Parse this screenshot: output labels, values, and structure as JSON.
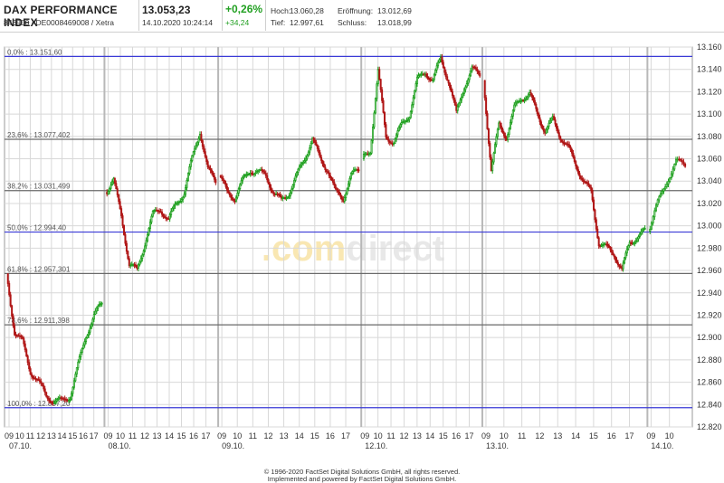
{
  "header": {
    "title": "DAX PERFORMANCE INDEX",
    "subtitle": "846900 / DE0008469008 / Xetra",
    "price": "13.053,23",
    "datetime": "14.10.2020 10:24:14",
    "change_pct": "+0,26%",
    "change_abs": "+34,24",
    "stats": {
      "high_label": "Hoch:",
      "high": "13.060,28",
      "open_label": "Eröffnung:",
      "open": "13.012,69",
      "low_label": "Tief:",
      "low": "12.997,61",
      "close_label": "Schluss:",
      "close": "13.018,99"
    }
  },
  "watermark": {
    "part1": ".com",
    "part2": "direct"
  },
  "footer": {
    "line1": "© 1996-2020 FactSet Digital Solutions GmbH, all rights reserved.",
    "line2": "Implemented and powered by FactSet Digital Solutions GmbH."
  },
  "colors": {
    "up": "#1a9e1a",
    "down": "#b01616",
    "fib_blue": "#3a3ad6",
    "fib_gray": "#6a6a6a",
    "grid": "#d8d8d8",
    "day_sep": "#b8b8b8"
  },
  "chart_data": {
    "type": "candlestick",
    "ylim": [
      12820,
      13160
    ],
    "y_ticks": [
      "13.160",
      "13.140",
      "13.120",
      "13.100",
      "13.080",
      "13.060",
      "13.040",
      "13.020",
      "13.000",
      "12.980",
      "12.960",
      "12.940",
      "12.920",
      "12.900",
      "12.880",
      "12.860",
      "12.840",
      "12.820"
    ],
    "y_tick_values": [
      13160,
      13140,
      13120,
      13100,
      13080,
      13060,
      13040,
      13020,
      13000,
      12980,
      12960,
      12940,
      12920,
      12900,
      12880,
      12860,
      12840,
      12820
    ],
    "fib_levels": [
      {
        "label": "0,0% : 13.151,60",
        "value": 13151.6,
        "color": "blue"
      },
      {
        "label": "23,6% : 13.077,402",
        "value": 13077.402,
        "color": "gray"
      },
      {
        "label": "38,2% : 13.031,499",
        "value": 13031.499,
        "color": "gray"
      },
      {
        "label": "50,0% : 12.994,40",
        "value": 12994.4,
        "color": "blue"
      },
      {
        "label": "61,8% : 12.957,301",
        "value": 12957.301,
        "color": "gray"
      },
      {
        "label": "78,6% : 12.911,398",
        "value": 12911.398,
        "color": "gray"
      },
      {
        "label": "100,0% : 12.837,20",
        "value": 12837.2,
        "color": "blue"
      }
    ],
    "days": [
      {
        "label": "07.10.",
        "hours": [
          "09",
          "10",
          "11",
          "12",
          "13",
          "14",
          "15",
          "16",
          "17"
        ],
        "path": [
          12957,
          12905,
          12896,
          12870,
          12860,
          12848,
          12843,
          12843,
          12848,
          12875,
          12902,
          12920,
          12930
        ]
      },
      {
        "label": "08.10.",
        "hours": [
          "09",
          "10",
          "11",
          "12",
          "13",
          "14",
          "15",
          "16",
          "17"
        ],
        "path": [
          13030,
          13040,
          13010,
          12965,
          12960,
          12985,
          13010,
          13015,
          13005,
          13020,
          13030,
          13060,
          13085,
          13050,
          13040
        ]
      },
      {
        "label": "09.10.",
        "hours": [
          "09",
          "10",
          "11",
          "12",
          "13",
          "14",
          "15",
          "16",
          "17"
        ],
        "path": [
          13045,
          13030,
          13025,
          13040,
          13050,
          13048,
          13045,
          13030,
          13022,
          13030,
          13045,
          13060,
          13078,
          13060,
          13050,
          13030,
          13025,
          13045,
          13050
        ]
      },
      {
        "label": "12.10.",
        "hours": [
          "09",
          "10",
          "11",
          "12",
          "13",
          "14",
          "15",
          "16",
          "17"
        ],
        "path": [
          13060,
          13068,
          13138,
          13080,
          13075,
          13090,
          13100,
          13130,
          13138,
          13130,
          13150,
          13130,
          13100,
          13125,
          13140,
          13135
        ]
      },
      {
        "label": "13.10.",
        "hours": [
          "09",
          "10",
          "11",
          "12",
          "13",
          "14",
          "15",
          "16",
          "17"
        ],
        "path": [
          13130,
          13050,
          13090,
          13080,
          13105,
          13115,
          13118,
          13100,
          13085,
          13095,
          13080,
          13070,
          13055,
          13040,
          13030,
          12985,
          12980,
          12975,
          12960,
          12985,
          12990,
          12995
        ]
      },
      {
        "label": "14.10.",
        "hours": [
          "09",
          "10"
        ],
        "path": [
          12995,
          13020,
          13040,
          13058,
          13053
        ]
      }
    ]
  }
}
